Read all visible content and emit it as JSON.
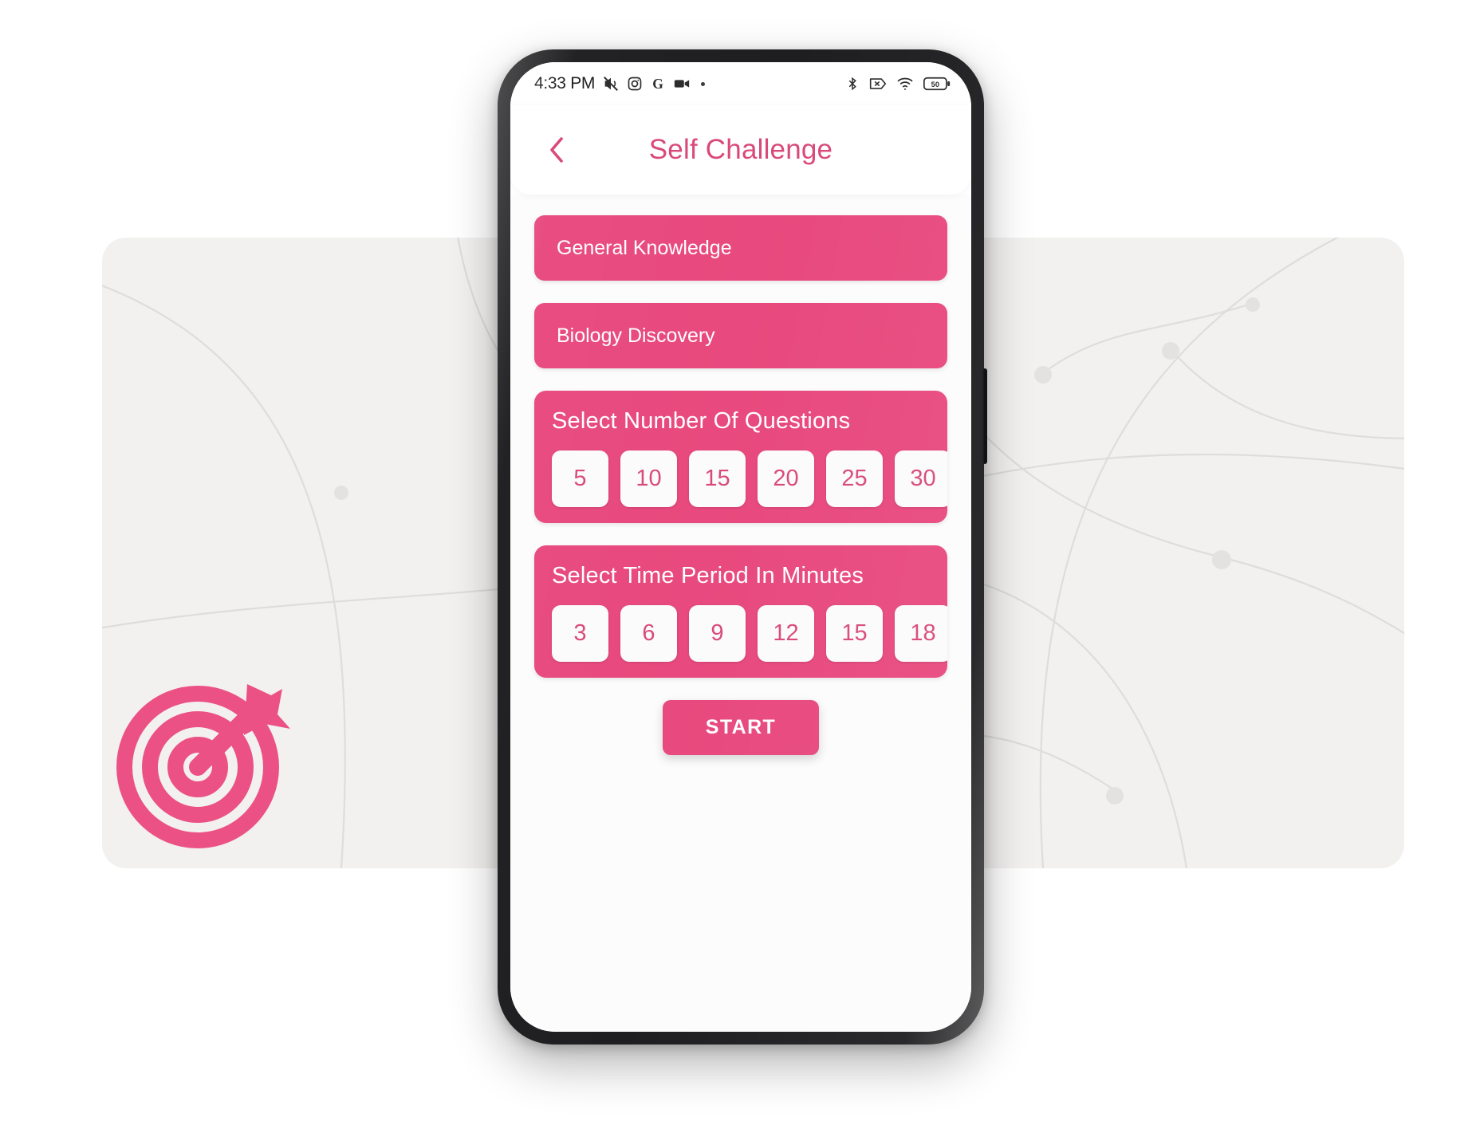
{
  "status_bar": {
    "time": "4:33 PM",
    "left_icons": [
      "mute-icon",
      "instagram-icon",
      "google-icon",
      "video-camera-icon",
      "dot-icon"
    ],
    "right_icons": [
      "bluetooth-icon",
      "no-sim-icon",
      "wifi-icon",
      "battery-icon"
    ],
    "battery_level": "50"
  },
  "header": {
    "back_icon": "chevron-left-icon",
    "title": "Self Challenge"
  },
  "topics": [
    {
      "label": "General Knowledge"
    },
    {
      "label": "Biology Discovery"
    }
  ],
  "questions_card": {
    "title": "Select Number Of Questions",
    "options": [
      "5",
      "10",
      "15",
      "20",
      "25",
      "30"
    ]
  },
  "time_card": {
    "title": "Select Time Period In Minutes",
    "options": [
      "3",
      "6",
      "9",
      "12",
      "15",
      "18"
    ]
  },
  "start": {
    "label": "START"
  },
  "branding": {
    "logo_icon": "target-dartboard-icon"
  },
  "colors": {
    "accent_pink": "#E8497E",
    "title_pink": "#D94A79",
    "background_card": "#F2F1F0",
    "phone_frame": "#1E1E20"
  }
}
